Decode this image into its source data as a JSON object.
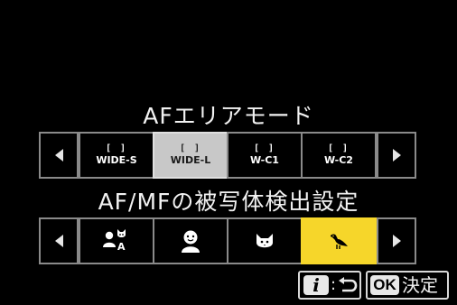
{
  "af_area_mode": {
    "title": "AFエリアモード",
    "options": [
      {
        "label": "WIDE-S",
        "selected": false
      },
      {
        "label": "WIDE-L",
        "selected": true
      },
      {
        "label": "W-C1",
        "selected": false
      },
      {
        "label": "W-C2",
        "selected": false
      }
    ],
    "bracket_glyph": "[ ]",
    "selected_color": "#c8c8c8"
  },
  "subject_detection": {
    "title": "AF/MFの被写体検出設定",
    "options": [
      {
        "icon": "auto-subject-icon",
        "badge": "A",
        "selected": false
      },
      {
        "icon": "person-face-icon",
        "selected": false
      },
      {
        "icon": "animal-face-icon",
        "selected": false
      },
      {
        "icon": "bird-icon",
        "selected": true
      }
    ],
    "selected_color": "#f6d62a"
  },
  "footer": {
    "info_button": {
      "label": "i",
      "separator": ":",
      "icon": "return-arrow-icon"
    },
    "ok_button": {
      "badge": "OK",
      "label": "決定"
    }
  }
}
